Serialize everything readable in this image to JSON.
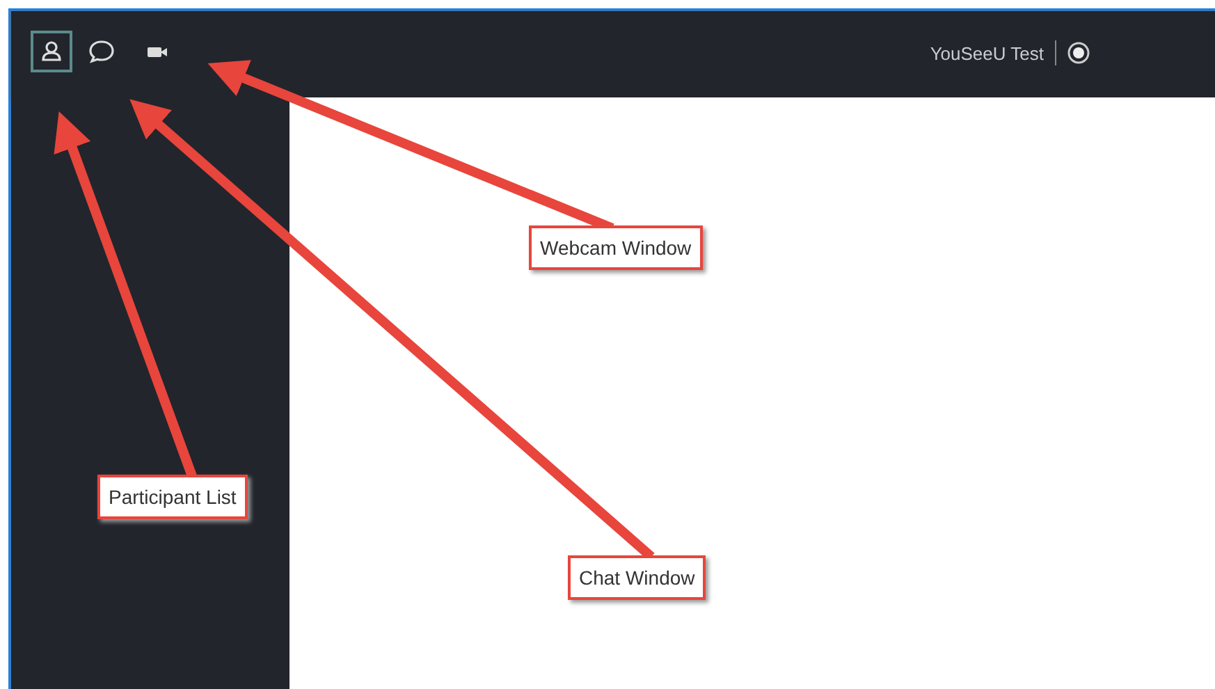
{
  "toolbar": {
    "tools": [
      {
        "kind": "participants",
        "selected": true
      },
      {
        "kind": "chat",
        "selected": false
      },
      {
        "kind": "webcam",
        "selected": false
      }
    ],
    "title": "YouSeeU Test"
  },
  "callouts": [
    {
      "text": "Webcam Window"
    },
    {
      "text": "Participant List"
    },
    {
      "text": "Chat Window"
    }
  ]
}
